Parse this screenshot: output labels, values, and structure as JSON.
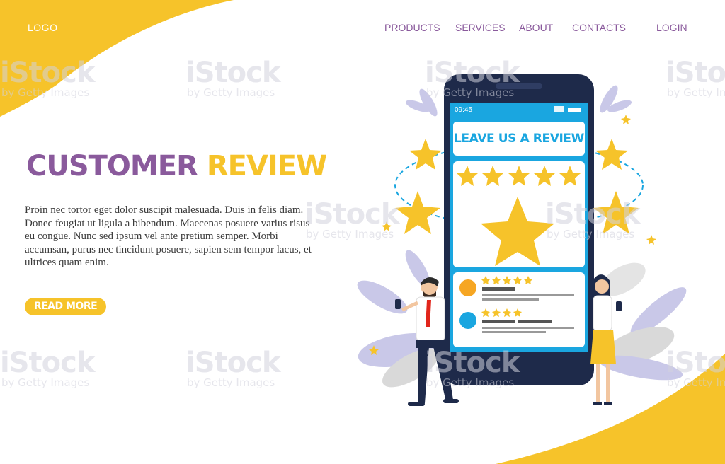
{
  "header": {
    "logo": "LOGO",
    "nav": [
      {
        "label": "PRODUCTS"
      },
      {
        "label": "SERVICES"
      },
      {
        "label": "ABOUT"
      },
      {
        "label": "CONTACTS"
      },
      {
        "label": "LOGIN"
      }
    ]
  },
  "hero": {
    "title_part1": "CUSTOMER",
    "title_part2": "REVIEW",
    "body": "Proin nec tortor eget dolor suscipit malesuada. Duis in felis diam. Donec feugiat ut ligula a bibendum. Maecenas posuere varius risus eu congue. Nunc sed ipsum vel ante pretium semper. Morbi accumsan, purus nec tincidunt posuere, sapien sem tempor lacus, et ultrices quam enim.",
    "button": "READ MORE"
  },
  "phone": {
    "time": "09:45",
    "review_heading": "LEAVE US A REVIEW",
    "review_rating": 5,
    "reviews": [
      {
        "stars": 5,
        "avatar_color": "#f6a623"
      },
      {
        "stars": 4,
        "avatar_color": "#1aa6e0"
      }
    ]
  },
  "watermark": {
    "brand": "iStock",
    "byline": "by Getty Images"
  },
  "colors": {
    "accent_yellow": "#f6c32a",
    "brand_purple": "#8a5a9c",
    "phone_blue": "#1aa6e0",
    "phone_dark": "#1e2a4a"
  }
}
